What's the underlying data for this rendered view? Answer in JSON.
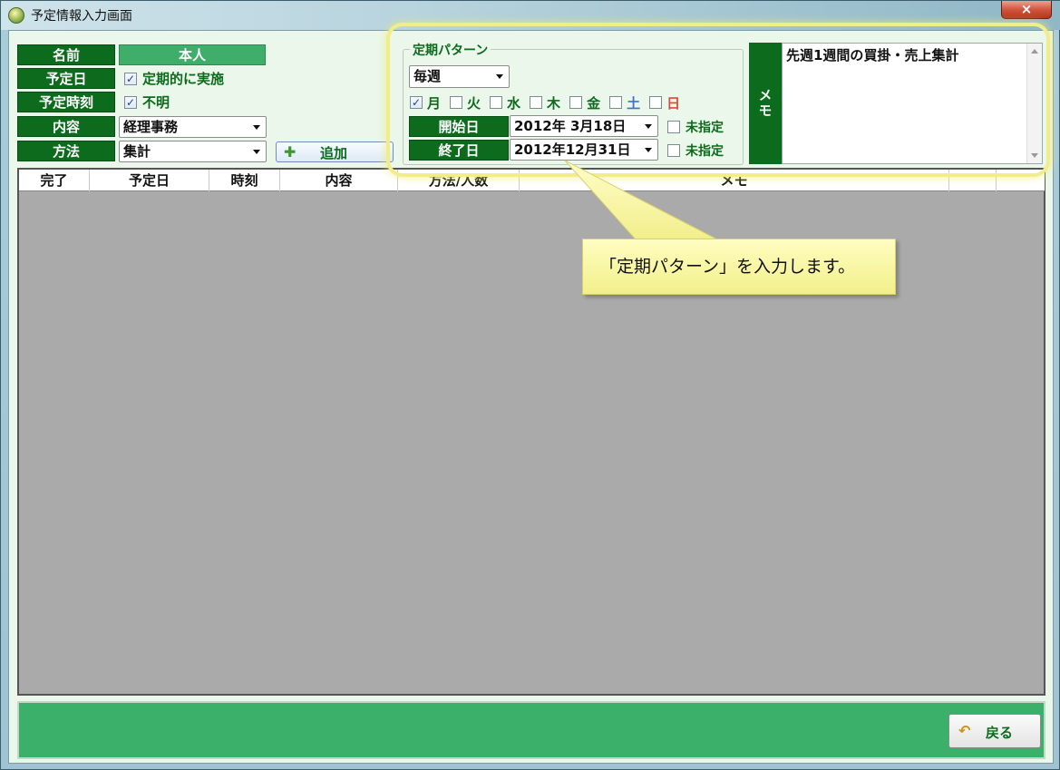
{
  "window": {
    "title": "予定情報入力画面",
    "close_label": "×"
  },
  "form": {
    "name_label": "名前",
    "name_value": "本人",
    "date_label": "予定日",
    "date_check_label": "定期的に実施",
    "date_checked": true,
    "time_label": "予定時刻",
    "time_check_label": "不明",
    "time_checked": true,
    "content_label": "内容",
    "content_value": "経理事務",
    "method_label": "方法",
    "method_value": "集計",
    "add_button_label": "追加"
  },
  "grid": {
    "columns": [
      "完了",
      "予定日",
      "時刻",
      "内容",
      "方法/人数",
      "メモ"
    ],
    "rows": []
  },
  "pattern": {
    "legend": "定期パターン",
    "frequency_value": "毎週",
    "days": [
      {
        "label": "月",
        "checked": true,
        "color": "#0c6b1c"
      },
      {
        "label": "火",
        "checked": false,
        "color": "#0c6b1c"
      },
      {
        "label": "水",
        "checked": false,
        "color": "#0c6b1c"
      },
      {
        "label": "木",
        "checked": false,
        "color": "#0c6b1c"
      },
      {
        "label": "金",
        "checked": false,
        "color": "#0c6b1c"
      },
      {
        "label": "土",
        "checked": false,
        "color": "#3f6fd8"
      },
      {
        "label": "日",
        "checked": false,
        "color": "#e04a3a"
      }
    ],
    "start_label": "開始日",
    "start_value": "2012年  3月18日",
    "start_unspecified_label": "未指定",
    "end_label": "終了日",
    "end_value": "2012年12月31日",
    "end_unspecified_label": "未指定"
  },
  "memo": {
    "label": "メモ",
    "text": "先週1週間の買掛・売上集計"
  },
  "callout": {
    "text": "「定期パターン」を入力します。"
  },
  "footer": {
    "back_button_label": "戻る"
  }
}
